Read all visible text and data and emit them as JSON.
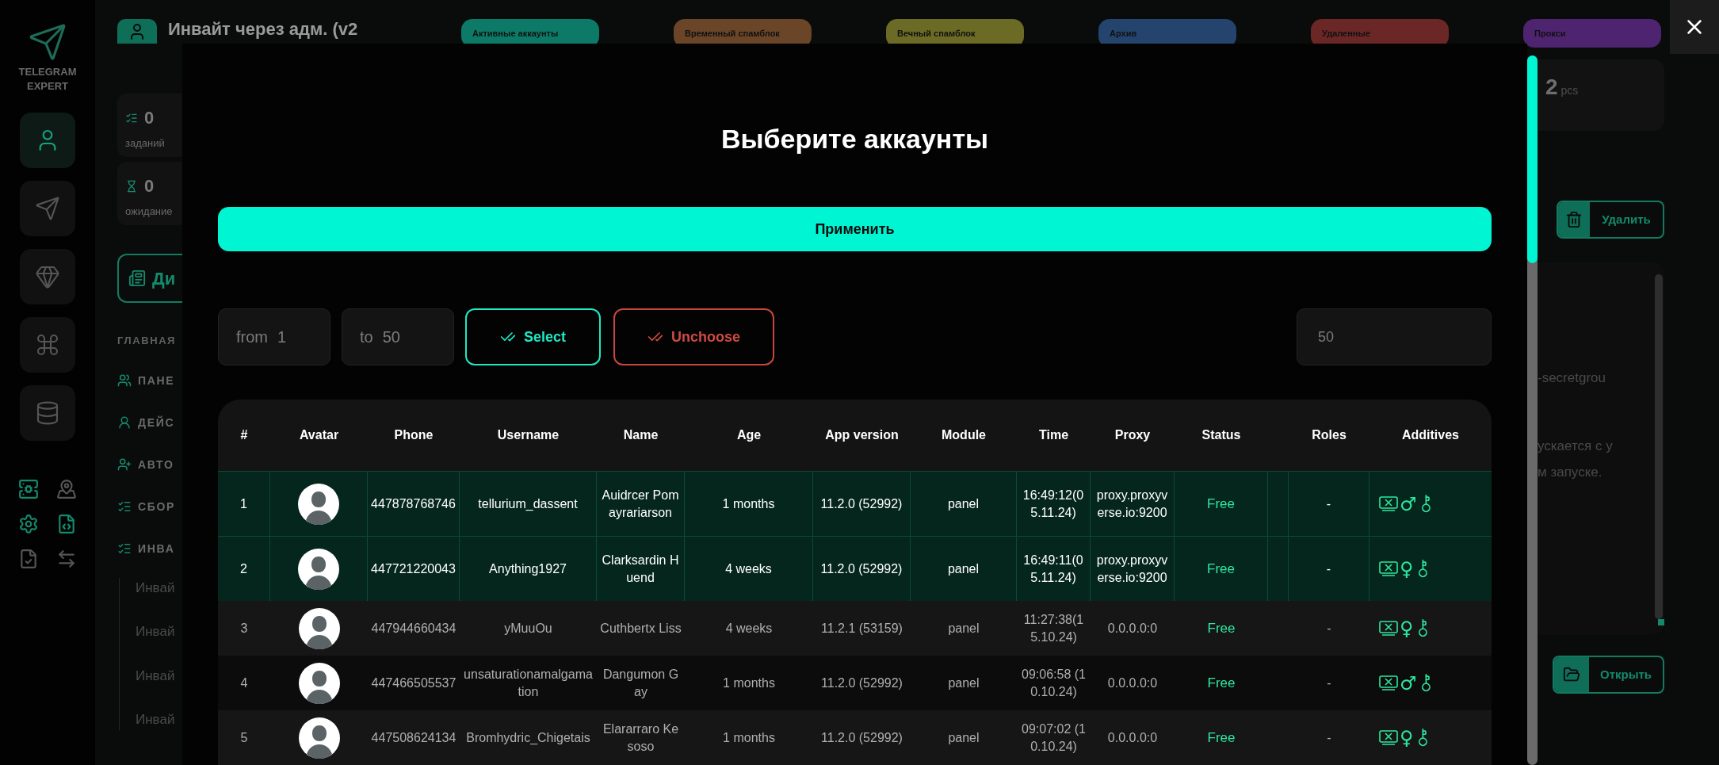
{
  "sidebar": {
    "logo_text": "TELEGRAM EXPERT",
    "rail_items": [
      {
        "selected": true
      },
      {
        "selected": false
      },
      {
        "selected": false
      },
      {
        "selected": false
      },
      {
        "selected": false
      }
    ]
  },
  "header": {
    "title": "Инвайт через адм. (v2"
  },
  "tabs": [
    {
      "label": "Активные аккаунты",
      "color": "#0c7a66"
    },
    {
      "label": "Временный спамблок",
      "color": "#6a4528"
    },
    {
      "label": "Вечный спамблок",
      "color": "#6b6b25"
    },
    {
      "label": "Архив",
      "color": "#24446e"
    },
    {
      "label": "Удаленные",
      "color": "#6b2626"
    },
    {
      "label": "Прокси",
      "color": "#4e2470"
    }
  ],
  "stats": [
    {
      "value": "0",
      "label": "заданий"
    },
    {
      "value": "0",
      "label": "ожидание"
    }
  ],
  "left_button": "Ди",
  "section_title": "ГЛАВНАЯ",
  "menu": [
    {
      "label": "ПАНЕ"
    },
    {
      "label": "ДЕЙС"
    },
    {
      "label": "АВТО"
    },
    {
      "label": "СБОР"
    },
    {
      "label": "ИНВА"
    }
  ],
  "submenu": [
    "Инвай",
    "Инвай",
    "Инвай",
    "Инвай"
  ],
  "right_panel": {
    "count": "2",
    "unit": "pcs",
    "delete_button": "Удалить",
    "text_lines": [
      "-secretgrou",
      "ускается с у",
      "м запуске."
    ],
    "open_button": "Открыть"
  },
  "modal": {
    "title": "Выберите аккаунты",
    "apply_button": "Применить",
    "from": {
      "label": "from",
      "value": "1"
    },
    "to": {
      "label": "to",
      "value": "50"
    },
    "select_button": "Select",
    "unchoose_button": "Unchoose",
    "count_field": {
      "placeholder": "50"
    },
    "table": {
      "columns": [
        "#",
        "Avatar",
        "Phone",
        "Username",
        "Name",
        "Age",
        "App version",
        "Module",
        "Time",
        "Proxy",
        "Status",
        "Roles",
        "Additives"
      ],
      "rows": [
        {
          "selected": true,
          "num": "1",
          "phone": "447878768746",
          "username": "tellurium_dassent",
          "name": "Auidrcer Pomayrariarson",
          "age": "1 months",
          "app_version": "11.2.0 (52992)",
          "module": "panel",
          "time": "16:49:12(05.11.24)",
          "proxy": "proxy.proxyverse.io:9200",
          "status": "Free",
          "roles": "-",
          "gender": "♂"
        },
        {
          "selected": true,
          "num": "2",
          "phone": "447721220043",
          "username": "Anything1927",
          "name": "Clarksardin Huend",
          "age": "4 weeks",
          "app_version": "11.2.0 (52992)",
          "module": "panel",
          "time": "16:49:11(05.11.24)",
          "proxy": "proxy.proxyverse.io:9200",
          "status": "Free",
          "roles": "-",
          "gender": "♀"
        },
        {
          "selected": false,
          "num": "3",
          "phone": "447944660434",
          "username": "yMuuOu",
          "name": "Cuthbertx Liss",
          "age": "4 weeks",
          "app_version": "11.2.1 (53159)",
          "module": "panel",
          "time": "11:27:38(15.10.24)",
          "proxy": "0.0.0.0:0",
          "status": "Free",
          "roles": "-",
          "gender": "♀"
        },
        {
          "selected": false,
          "num": "4",
          "phone": "447466505537",
          "username": "unsaturationamalgamation",
          "name": "Dangumon Gay",
          "age": "1 months",
          "app_version": "11.2.0 (52992)",
          "module": "panel",
          "time": "09:06:58 (10.10.24)",
          "proxy": "0.0.0.0:0",
          "status": "Free",
          "roles": "-",
          "gender": "♂"
        },
        {
          "selected": false,
          "num": "5",
          "phone": "447508624134",
          "username": "Bromhydric_Chigetais",
          "name": "Elararraro Kesoso",
          "age": "1 months",
          "app_version": "11.2.0 (52992)",
          "module": "panel",
          "time": "09:07:02 (10.10.24)",
          "proxy": "0.0.0.0:0",
          "status": "Free",
          "roles": "-",
          "gender": "♀"
        }
      ]
    }
  }
}
